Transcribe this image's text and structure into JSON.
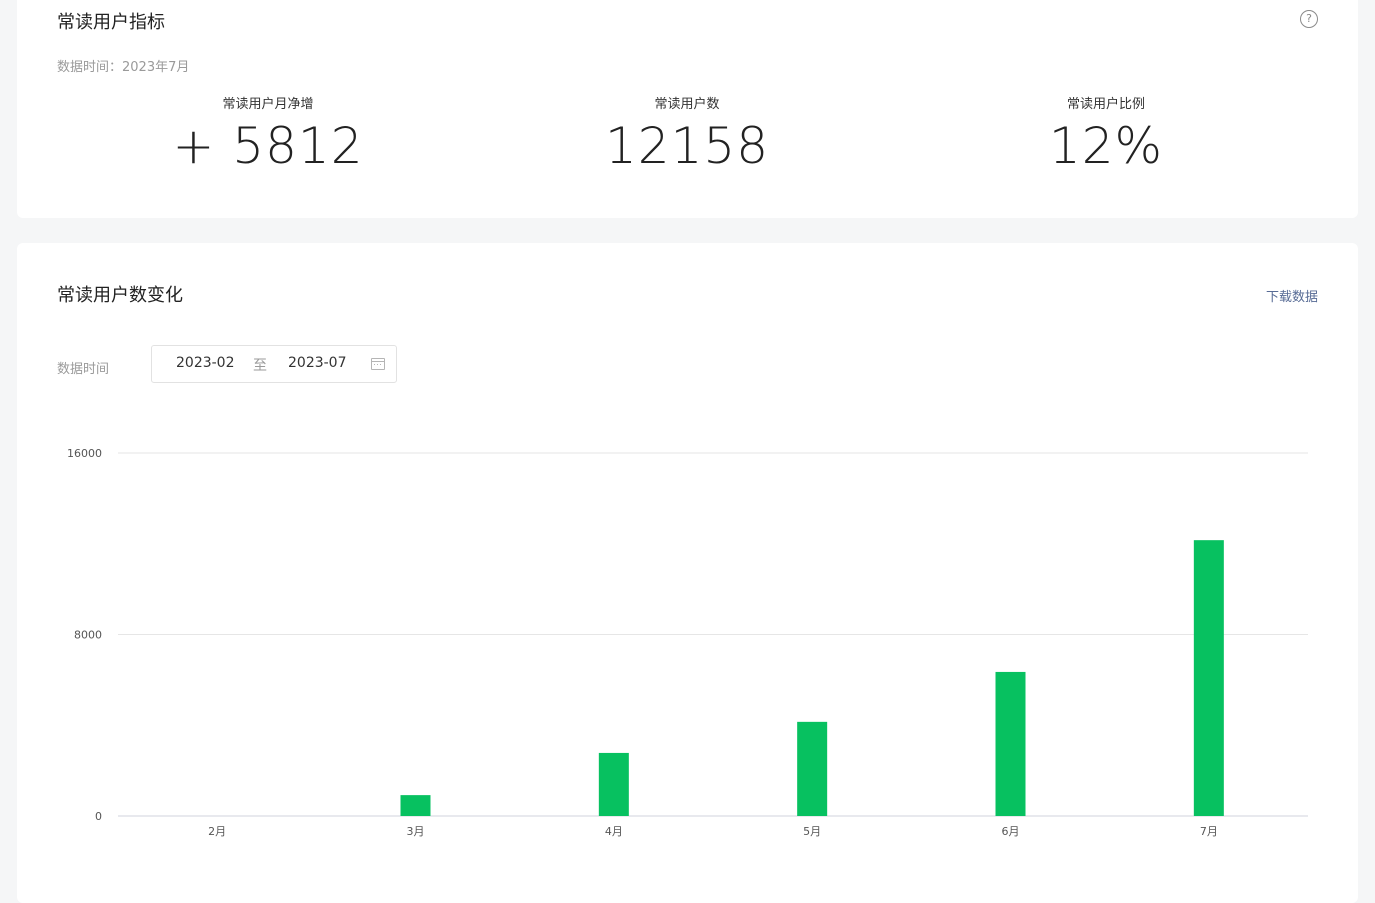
{
  "overview": {
    "title": "常读用户指标",
    "data_time": "数据时间：2023年7月",
    "metrics": [
      {
        "label": "常读用户月净增",
        "value": "+ 5812"
      },
      {
        "label": "常读用户数",
        "value": "12158"
      },
      {
        "label": "常读用户比例",
        "value": "12%"
      }
    ]
  },
  "trend": {
    "title": "常读用户数变化",
    "download_label": "下载数据",
    "filter_label": "数据时间",
    "range": {
      "start": "2023-02",
      "separator": "至",
      "end": "2023-07"
    }
  },
  "colors": {
    "bar": "#07c160",
    "grid": "#e6e6e6",
    "link": "#576b95"
  },
  "icons": [
    "help-icon",
    "calendar-icon"
  ],
  "chart_data": {
    "type": "bar",
    "categories": [
      "2月",
      "3月",
      "4月",
      "5月",
      "6月",
      "7月"
    ],
    "values": [
      0,
      920,
      2780,
      4150,
      6350,
      12158
    ],
    "ylim": [
      0,
      16000
    ],
    "yticks": [
      0,
      8000,
      16000
    ],
    "grid": true,
    "legend": "none"
  }
}
